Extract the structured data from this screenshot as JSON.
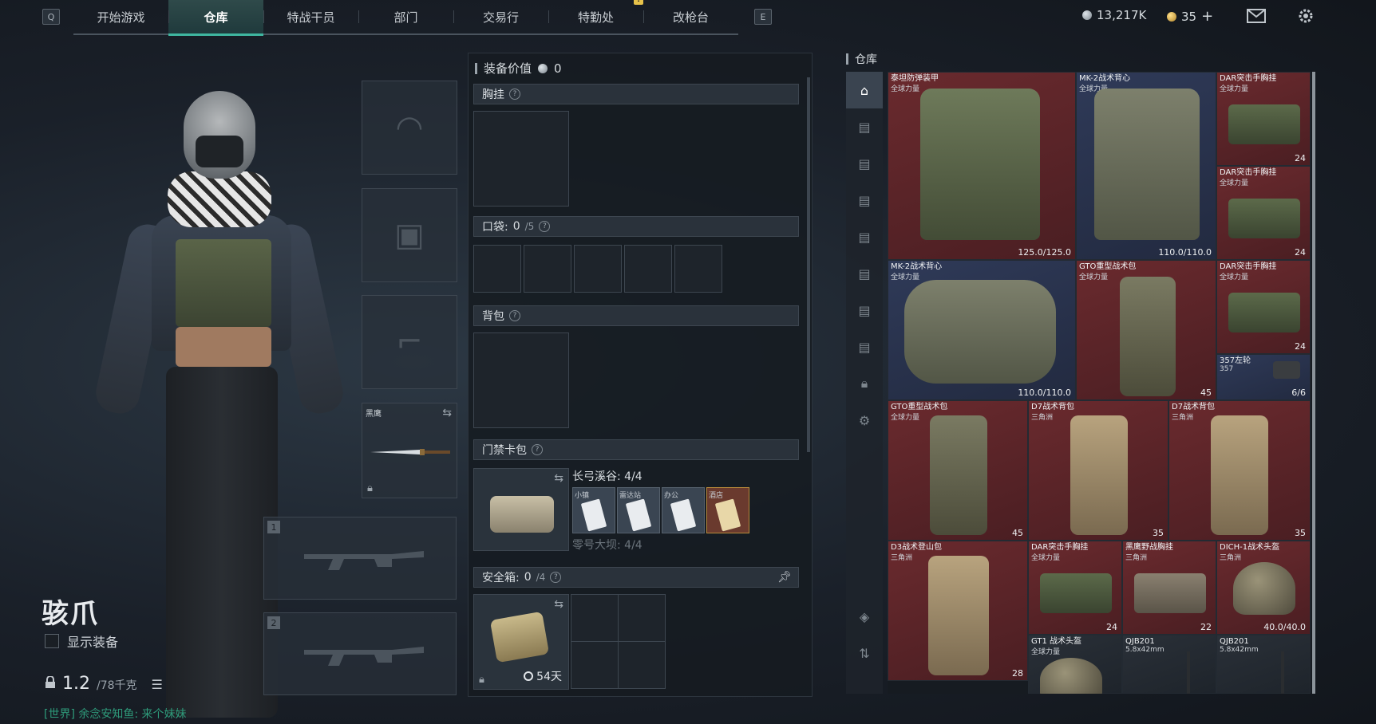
{
  "nav": {
    "left_key": "Q",
    "right_key": "E",
    "tabs": [
      {
        "label": "开始游戏"
      },
      {
        "label": "仓库"
      },
      {
        "label": "特战干员"
      },
      {
        "label": "部门"
      },
      {
        "label": "交易行"
      },
      {
        "label": "特勤处"
      },
      {
        "label": "改枪台"
      }
    ],
    "badge": "!",
    "currency_silver": "13,217K",
    "currency_gold": "35",
    "plus": "+"
  },
  "character": {
    "name": "骇爪",
    "show_equipment_label": "显示装备",
    "weight_value": "1.2",
    "weight_max": "/78千克",
    "chat": "[世界] 余念安知鱼: 来个妹妹"
  },
  "slots": {
    "melee_label": "黑鹰",
    "weapon1_num": "1",
    "weapon2_num": "2"
  },
  "gear": {
    "title": "装备价值",
    "value": "0",
    "chest_rig": "胸挂",
    "pockets_label": "口袋:",
    "pockets_count": "0",
    "pockets_max": "/5",
    "backpack": "背包",
    "keycard_bag": "门禁卡包",
    "keycard_map1": "长弓溪谷: 4/4",
    "keycard_map2": "零号大坝: 4/4",
    "cards": [
      "小镇",
      "雷达站",
      "办公",
      "酒店"
    ],
    "safe_box_label": "安全箱:",
    "safe_box_count": "0",
    "safe_box_max": "/4",
    "safe_timer": "54天"
  },
  "warehouse": {
    "title": "仓库",
    "items": [
      {
        "name": "泰坦防弹装甲",
        "sub": "全球力量",
        "val": "125.0/125.0",
        "color": "red"
      },
      {
        "name": "MK-2战术背心",
        "sub": "全球力量",
        "val": "110.0/110.0",
        "color": "blue"
      },
      {
        "name": "DAR突击手胸挂",
        "sub": "全球力量",
        "val": "24",
        "color": "red"
      },
      {
        "name": "DAR突击手胸挂",
        "sub": "全球力量",
        "val": "24",
        "color": "red"
      },
      {
        "name": "MK-2战术背心",
        "sub": "全球力量",
        "val": "110.0/110.0",
        "color": "blue"
      },
      {
        "name": "GTO重型战术包",
        "sub": "全球力量",
        "val": "45",
        "color": "red"
      },
      {
        "name": "DAR突击手胸挂",
        "sub": "全球力量",
        "val": "24",
        "color": "red"
      },
      {
        "name": "357左轮",
        "sub": "357",
        "val": "6/6",
        "color": "blue"
      },
      {
        "name": "GTO重型战术包",
        "sub": "全球力量",
        "val": "45",
        "color": "red"
      },
      {
        "name": "D7战术背包",
        "sub": "三角洲",
        "val": "35",
        "color": "red"
      },
      {
        "name": "D7战术背包",
        "sub": "三角洲",
        "val": "35",
        "color": "red"
      },
      {
        "name": "D3战术登山包",
        "sub": "三角洲",
        "val": "28",
        "color": "red"
      },
      {
        "name": "DAR突击手胸挂",
        "sub": "全球力量",
        "val": "24",
        "color": "red"
      },
      {
        "name": "黑鹰野战胸挂",
        "sub": "三角洲",
        "val": "22",
        "color": "red"
      },
      {
        "name": "DICH-1战术头盔",
        "sub": "三角洲",
        "val": "40.0/40.0",
        "color": "red"
      },
      {
        "name": "GT1 战术头盔",
        "sub": "全球力量",
        "val": "",
        "color": "dark"
      },
      {
        "name": "QJB201",
        "sub": "5.8x42mm",
        "val": "",
        "color": "dark"
      },
      {
        "name": "QJB201",
        "sub": "5.8x42mm",
        "val": "",
        "color": "dark"
      }
    ]
  }
}
